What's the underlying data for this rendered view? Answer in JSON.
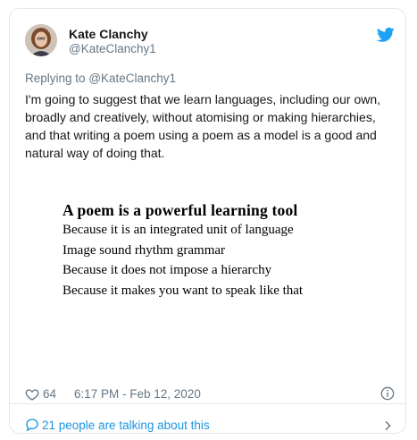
{
  "author": {
    "name": "Kate Clanchy",
    "handle": "@KateClanchy1"
  },
  "reply": {
    "prefix": "Replying to",
    "mention": "@KateClanchy1"
  },
  "tweet_text": "I'm going to suggest that we learn languages, including our own, broadly and creatively, without atomising or making hierarchies, and that writing a poem using a poem as a model is a good and natural way of doing that.",
  "image_text": {
    "title": "A poem is a powerful learning tool",
    "lines": [
      "Because it is an integrated unit of language",
      "Image sound rhythm grammar",
      "Because it does not impose a hierarchy",
      "Because it makes you want to speak like that"
    ]
  },
  "meta": {
    "likes": "64",
    "timestamp": "6:17 PM - Feb 12, 2020"
  },
  "conversation": {
    "label": "21 people are talking about this"
  },
  "icons": [
    "twitter-bird-icon",
    "heart-icon",
    "info-icon",
    "speech-bubble-icon",
    "chevron-right-icon"
  ],
  "colors": {
    "twitter_blue": "#1da1f2",
    "link_blue": "#1b95e0",
    "secondary_text": "#657786",
    "border": "#e1e8ed"
  }
}
